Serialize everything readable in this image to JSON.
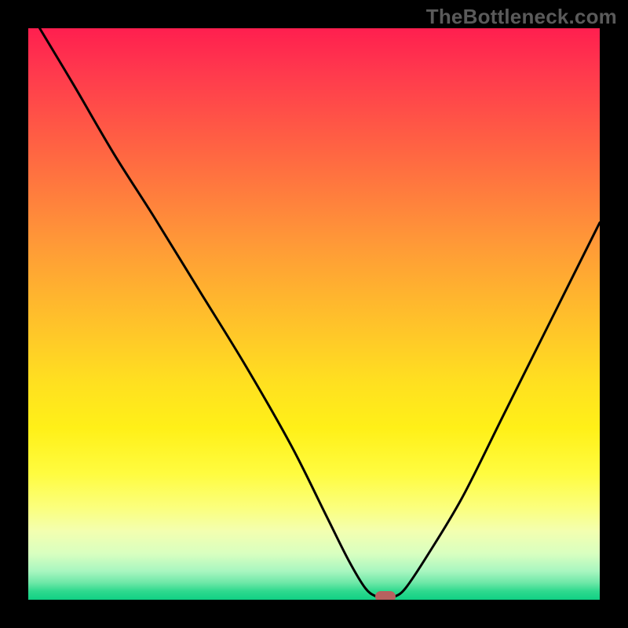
{
  "watermark": "TheBottleneck.com",
  "chart_data": {
    "type": "line",
    "title": "",
    "xlabel": "",
    "ylabel": "",
    "xlim": [
      0,
      100
    ],
    "ylim": [
      0,
      100
    ],
    "grid": false,
    "series": [
      {
        "name": "bottleneck-curve",
        "x": [
          2,
          8,
          15,
          22,
          30,
          38,
          46,
          52,
          56,
          59,
          61,
          62.5,
          64,
          66,
          70,
          76,
          83,
          90,
          97,
          100
        ],
        "y": [
          100,
          90,
          78,
          67,
          54,
          41,
          27,
          15,
          7,
          2,
          0.5,
          0,
          0.5,
          2,
          8,
          18,
          32,
          46,
          60,
          66
        ]
      }
    ],
    "annotations": [
      {
        "name": "optimal-marker",
        "x": 62.5,
        "y": 0.5
      }
    ]
  },
  "colors": {
    "background": "#000000",
    "curve": "#000000",
    "marker": "#b7615f",
    "watermark": "#5a5a5a"
  }
}
